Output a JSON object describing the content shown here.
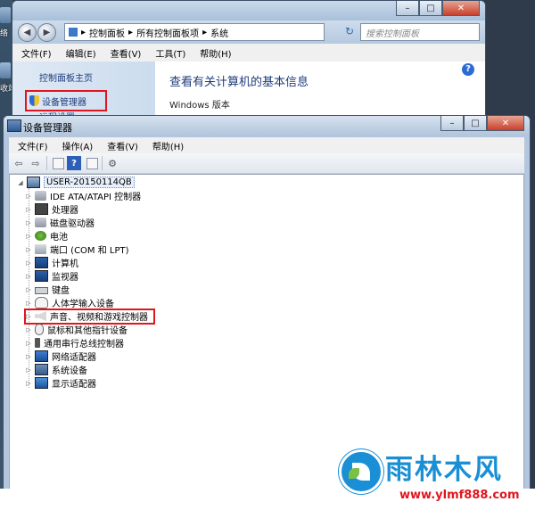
{
  "desktop": {
    "label_top": "络",
    "label_mid": "收站"
  },
  "control_panel": {
    "breadcrumb": [
      "控制面板",
      "所有控制面板项",
      "系统"
    ],
    "search_placeholder": "搜索控制面板",
    "menu": [
      "文件(F)",
      "编辑(E)",
      "查看(V)",
      "工具(T)",
      "帮助(H)"
    ],
    "sidebar": {
      "home": "控制面板主页",
      "device_manager": "设备管理器",
      "remote": "远程设置"
    },
    "heading": "查看有关计算机的基本信息",
    "windows_edition": "Windows 版本"
  },
  "device_manager": {
    "title": "设备管理器",
    "menu": [
      "文件(F)",
      "操作(A)",
      "查看(V)",
      "帮助(H)"
    ],
    "toolbar_help": "?",
    "root": "USER-20150114QB",
    "devices": [
      {
        "label": "IDE ATA/ATAPI 控制器",
        "icon": "disk-controller-icon"
      },
      {
        "label": "处理器",
        "icon": "processor-icon"
      },
      {
        "label": "磁盘驱动器",
        "icon": "disk-drive-icon"
      },
      {
        "label": "电池",
        "icon": "battery-icon"
      },
      {
        "label": "端口 (COM 和 LPT)",
        "icon": "port-icon"
      },
      {
        "label": "计算机",
        "icon": "computer-icon"
      },
      {
        "label": "监视器",
        "icon": "monitor-icon"
      },
      {
        "label": "键盘",
        "icon": "keyboard-icon"
      },
      {
        "label": "人体学输入设备",
        "icon": "hid-icon"
      },
      {
        "label": "声音、视频和游戏控制器",
        "icon": "sound-icon"
      },
      {
        "label": "鼠标和其他指针设备",
        "icon": "mouse-icon"
      },
      {
        "label": "通用串行总线控制器",
        "icon": "usb-icon"
      },
      {
        "label": "网络适配器",
        "icon": "network-adapter-icon"
      },
      {
        "label": "系统设备",
        "icon": "system-device-icon"
      },
      {
        "label": "显示适配器",
        "icon": "display-adapter-icon"
      }
    ]
  },
  "watermark": {
    "brand": "雨林木风",
    "url": "www.ylmf888.com"
  },
  "colors": {
    "highlight_red": "#e0161e",
    "brand_blue": "#1a8fd6"
  }
}
